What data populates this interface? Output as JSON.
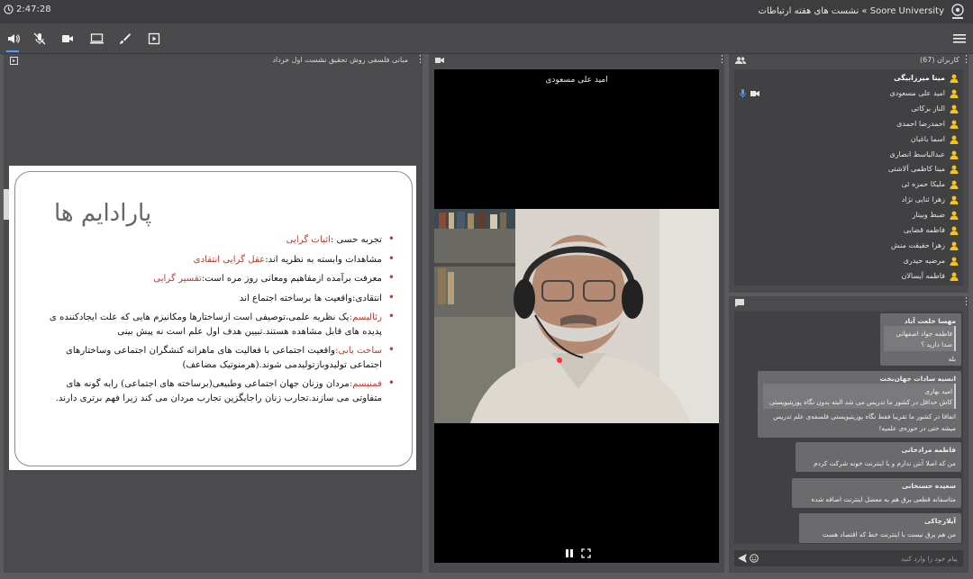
{
  "titlebar": {
    "clock": "2:47:28",
    "breadcrumb": "Soore University » نشست های هفته ارتباطات"
  },
  "presentation": {
    "title": "مبانی فلسفی روش تحقیق نشست اول خرداد",
    "slide_title": "پارادایم ها",
    "bullets": [
      {
        "text": "تجربه حسی :",
        "highlight": "اثبات گرایی"
      },
      {
        "text": "مشاهدات وابسته به نظریه اند:",
        "highlight": "عقل گرایی انتقادی"
      },
      {
        "text": "معرفت برآمده ازمفاهیم ومعانی روز مره است:",
        "highlight": "تفسیر گرایی"
      },
      {
        "text": "انتقادی:واقعیت ها برساخته اجتماع اند",
        "highlight": ""
      },
      {
        "highlight": "رئالیسم:",
        "text": "یک نظریه علمی،توصیفی است ازساختارها ومکانیزم هایی که علت ایجادکننده ی پدیده های قابل مشاهده هستند.تبیین هدف اول علم است نه پیش بینی"
      },
      {
        "highlight": "ساخت یابی:",
        "text": "واقعیت اجتماعی با فعالیت های ماهرانه کنشگران اجتماعی وساختارهای اجتماعی تولیدوبازتولیدمی شوند.(هرمنوتیک مضاعف)"
      },
      {
        "highlight": "فمنیسم:",
        "text": "مردان وزنان جهان اجتماعی وطبیعی(برساخته های اجتماعی) رابه گونه های متفاوتی می سازند.تجارب زنان راجایگزین تجارب مردان می کند زیرا فهم برتری دارند."
      }
    ]
  },
  "video": {
    "presenter_name": "امید علی مسعودی"
  },
  "users": {
    "header": "کاربران (67)",
    "list": [
      {
        "name": "مینا میرزابیگی",
        "me": true
      },
      {
        "name": "امید علی مسعودی",
        "me": false
      },
      {
        "name": "الناز برکاتی",
        "me": false
      },
      {
        "name": "احمدرضا احمدی",
        "me": false
      },
      {
        "name": "اسما باغبان",
        "me": false
      },
      {
        "name": "عبدالباسط انصاری",
        "me": false
      },
      {
        "name": "مینا کاظمی آلاشتی",
        "me": false
      },
      {
        "name": "ملیکا حمزه ئی",
        "me": false
      },
      {
        "name": "زهرا ثنایی نژاد",
        "me": false
      },
      {
        "name": "ضبط وبینار",
        "me": false
      },
      {
        "name": "فاطمه قضایی",
        "me": false
      },
      {
        "name": "زهرا حقیقت منش",
        "me": false
      },
      {
        "name": "مرضیه حیدری",
        "me": false
      },
      {
        "name": "فاطمه آیسالان",
        "me": false
      }
    ]
  },
  "chat": {
    "messages": [
      {
        "sender": "مهسا خلعت آباد",
        "quote": [
          "فاطمه جواد اصفهانی",
          "صدا دارید ؟"
        ],
        "lines": [
          "بله"
        ]
      },
      {
        "sender": "انسیه سادات جهان‌بخت",
        "quote": [
          "امید بهاری",
          "کاش حداقل در کشور ما تدریس می شد البته بدون نگاه پوزیتیویستی"
        ],
        "lines": [
          "اتفاقا در کشور ما تقریبا فقط نگاه پوزیتیویستی فلسفه‌ی علم تدریس",
          "میشه حتی در حوزه‌ی علمیه!"
        ]
      },
      {
        "sender": "فاطمه مرادخانی",
        "quote": [],
        "lines": [
          "من که اصلا آنتن ندارم و با اینترنت خونه شرکت کردم"
        ]
      },
      {
        "sender": "سعیده حسنخانی",
        "quote": [],
        "lines": [
          "متاسفانه قطعی برق هم به معضل اینترنت اضافه شده"
        ]
      },
      {
        "sender": "آیلارچاکی",
        "quote": [],
        "lines": [
          "من هم برق نیست با اینترنت خط که اقتصاد هست"
        ]
      }
    ],
    "input_placeholder": "پیام خود را وارد کنید"
  },
  "colors": {
    "accent": "#4aa0ff",
    "slide_highlight": "#c0392b",
    "user_icon": "#f5c518"
  }
}
